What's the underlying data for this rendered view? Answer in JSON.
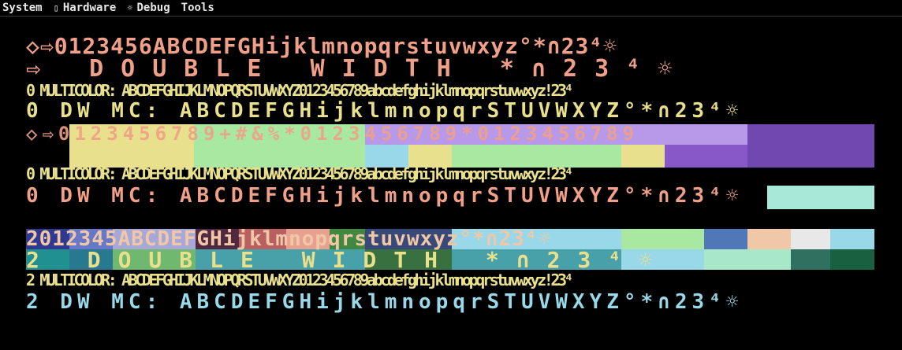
{
  "menubar": {
    "items": [
      {
        "label": "System",
        "icon": ""
      },
      {
        "label": "Hardware",
        "icon": "▯"
      },
      {
        "label": "Debug",
        "icon": "☼"
      },
      {
        "label": "Tools",
        "icon": ""
      }
    ]
  },
  "screen": {
    "colors": {
      "peach": "#f0a088",
      "yellow": "#e8e08c",
      "green": "#a8e8a0",
      "cyan": "#98d8e8",
      "purple": "#8858c8",
      "violet": "#6040a0",
      "teal": "#209090",
      "navy": "#303890"
    },
    "lines": [
      {
        "text": "◇⇨0123456ABCDEFGHijklmnopqrstuvwxyz°*∩23⁴☼",
        "style": "normal"
      },
      {
        "text": "⇨ DOUBLE WIDTH *∩23⁴☼",
        "style": "double"
      },
      {
        "text": "0 MULTICOLOR: ABCDEFGHIJKLMNOPQRSTUVWXYZ0123456789abcdefghijklmnopqrstuvwxyz!23⁴",
        "style": "narrow"
      },
      {
        "text": "0 DW MC: ABCDEFGHijklmnopqrSTUVWXYZ°*∩23⁴☼",
        "style": "dwmc"
      },
      {
        "text": "◇⇨0123456789+#&%*0123456789*0123456789",
        "style": "band"
      },
      {
        "text": "0 MULTICOLOR: ABCDEFGHIJKLMNOPQRSTUVWXYZ0123456789abcdefghijklmnopqrstuvwxyz!23⁴",
        "style": "narrow"
      },
      {
        "text": "0 DW MC: ABCDEFGHijklmnopqrSTUVWXYZ°*∩23⁴☼",
        "style": "dwmc"
      },
      {
        "text": "2012345ABCDEFGHijklmnopqrstuvwxyz°*∩23⁴☼",
        "style": "color"
      },
      {
        "text": "2 DOUBLE WIDTH *∩23⁴☼",
        "style": "double-color"
      },
      {
        "text": "2 MULTICOLOR: ABCDEFGHIJKLMNOPQRSTUVWXYZ0123456789abcdefghijklmnopqrstuvwxyz!23⁴",
        "style": "narrow"
      },
      {
        "text": "2 DW MC: ABCDEFGHijklmnopqrSTUVWXYZ°*∩23⁴☼",
        "style": "dwmc"
      }
    ]
  }
}
